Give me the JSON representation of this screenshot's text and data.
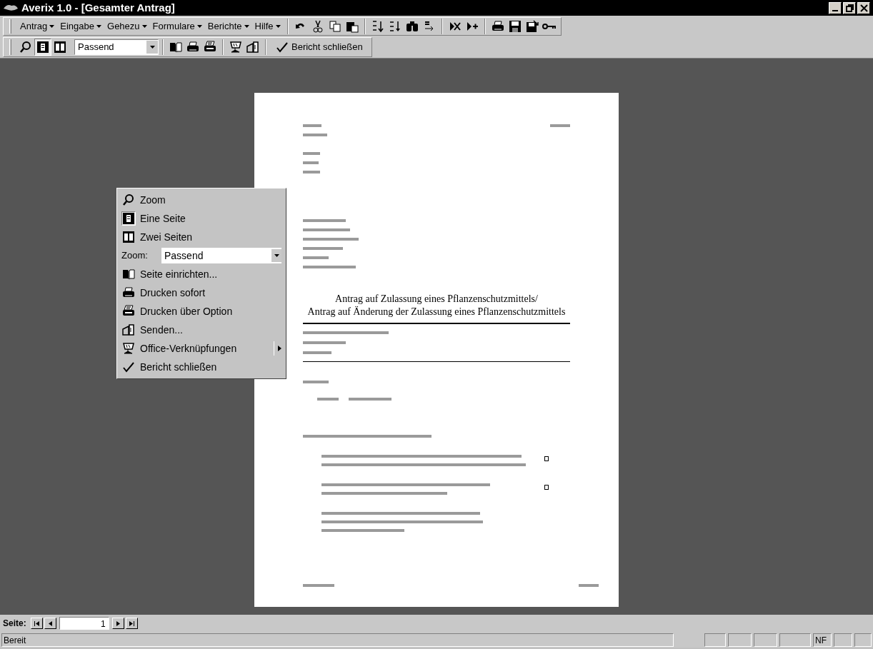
{
  "window": {
    "title": "Averix 1.0 - [Gesamter Antrag]"
  },
  "menu_bar": [
    {
      "label": "Antrag"
    },
    {
      "label": "Eingabe"
    },
    {
      "label": "Gehezu"
    },
    {
      "label": "Formulare"
    },
    {
      "label": "Berichte"
    },
    {
      "label": "Hilfe"
    }
  ],
  "preview_toolbar": {
    "single_page_selected": true,
    "zoom_value": "Passend",
    "close_label": "Bericht schließen"
  },
  "context_menu": [
    {
      "kind": "item",
      "label": "Zoom"
    },
    {
      "kind": "item",
      "label": "Eine Seite",
      "selected": true
    },
    {
      "kind": "item",
      "label": "Zwei Seiten",
      "selected": false
    },
    {
      "kind": "combo",
      "label": "Zoom:",
      "value": "Passend"
    },
    {
      "kind": "item",
      "label": "Seite einrichten..."
    },
    {
      "kind": "item",
      "label": "Drucken sofort"
    },
    {
      "kind": "item",
      "label": "Drucken über Option"
    },
    {
      "kind": "item",
      "label": "Senden..."
    },
    {
      "kind": "submenu",
      "label": "Office-Verknüpfungen"
    },
    {
      "kind": "item",
      "label": "Bericht schließen"
    }
  ],
  "document": {
    "title_lines": [
      "Antrag auf Zulassung eines Pflanzenschutzmittels/",
      "Antrag auf Änderung der Zulassung eines Pflanzenschutzmittels"
    ],
    "checkboxes": [
      {
        "checked": false
      },
      {
        "checked": false
      }
    ]
  },
  "page_navigation": {
    "label": "Seite:",
    "page": "1"
  },
  "status_bar": {
    "text": "Bereit",
    "panels": [
      {
        "text": "NF"
      }
    ]
  }
}
